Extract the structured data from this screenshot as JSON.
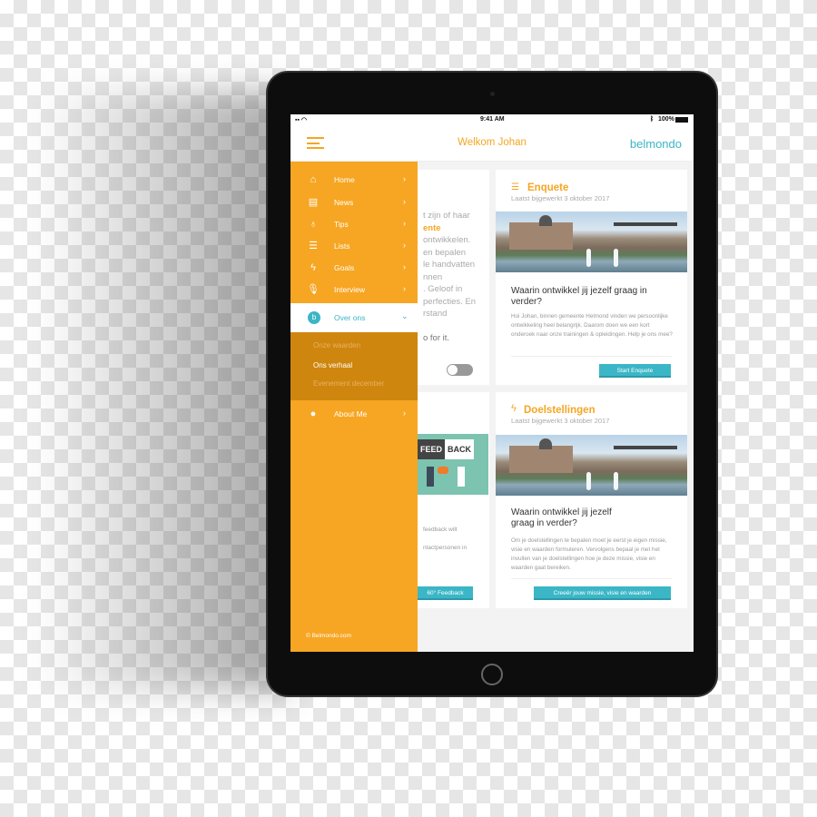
{
  "status": {
    "time": "9:41 AM",
    "battery": "100%"
  },
  "header": {
    "title": "Welkom Johan",
    "brand": "belmondo",
    "menu_icon": "hamburger-icon"
  },
  "menu": {
    "items": [
      {
        "label": "Home",
        "icon": "home-icon"
      },
      {
        "label": "News",
        "icon": "newspaper-icon"
      },
      {
        "label": "Tips",
        "icon": "lightbulb-icon"
      },
      {
        "label": "Lists",
        "icon": "list-icon"
      },
      {
        "label": "Goals",
        "icon": "lightning-icon"
      },
      {
        "label": "Interview",
        "icon": "microphone-icon"
      }
    ],
    "expanded": {
      "label": "Over ons",
      "badge": "b",
      "sub": [
        "Onze waarden",
        "Ons verhaal",
        "Evenement december"
      ]
    },
    "about": {
      "label": "About Me",
      "icon": "user-icon"
    },
    "footer": "© Belmondo.com"
  },
  "left_card": {
    "lines": [
      "t zijn of haar",
      "ente",
      "ontwikkelen.",
      "en bepalen",
      "le handvatten",
      "nnen",
      ". Geloof in",
      "perfecties. En",
      "rstand"
    ],
    "line2": "o for it.",
    "toggle_on": false
  },
  "left_card2": {
    "bubble1": "FEED",
    "bubble2": "BACK",
    "text1": "feedback wilt",
    "text2": "ntactpersonen in",
    "button": "60° Feedback"
  },
  "enquete": {
    "title": "Enquete",
    "updated": "Laatst bijgewerkt 3 oktober 2017",
    "question": "Waarin ontwikkel jij jezelf graag in verder?",
    "body": "Hoi Johan, binnen gemeente Helmond vinden we persoonlijke ontwikkeling heel belangrijk. Daarom doen we een kort onderoek naar onze trainingen & opleidingen. Help je ons mee?",
    "button": "Start Enquete"
  },
  "doel": {
    "title": "Doelstellingen",
    "updated": "Laatst bijgewerkt 3 oktober 2017",
    "question": "Waarin ontwikkel jij jezelf graag in verder?",
    "body": "Om je doelstellingen te bepalen moet je eerst je eigen missie, visie en waarden formuleren. Vervolgens bepaal je met het invullen van je doelstellingen hoe je deze missie, visie en waarden gaat bereiken.",
    "button": "Creeër jouw missie, visie en waarden"
  },
  "colors": {
    "accent": "#f6a623",
    "teal": "#3bb6c6",
    "submenu": "#cf860e"
  }
}
